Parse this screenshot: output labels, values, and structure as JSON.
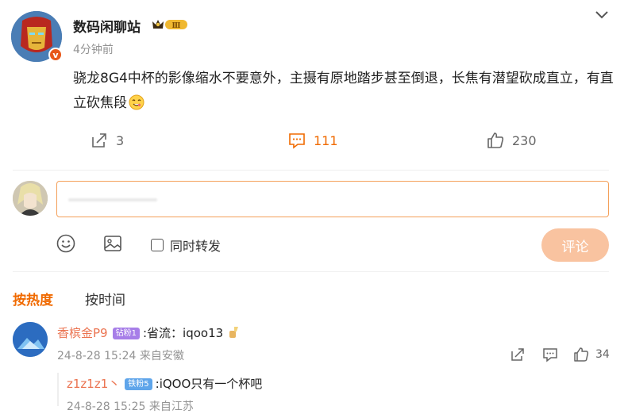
{
  "post": {
    "username": "数码闲聊站",
    "level_badge": "Ⅲ",
    "verified_badge": "v",
    "time": "4分钟前",
    "text": "骁龙8G4中杯的影像缩水不要意外，主摄有原地踏步甚至倒退，长焦有潜望砍成直立，有直立砍焦段",
    "text_emoji": "yummy-face-emoji"
  },
  "actions": {
    "share_count": "3",
    "comment_count": "111",
    "like_count": "230"
  },
  "compose": {
    "placeholder": "",
    "repost_label": "同时转发",
    "submit_label": "评论"
  },
  "sort": {
    "hot_label": "按热度",
    "time_label": "按时间"
  },
  "comments": [
    {
      "username": "香槟金P9",
      "badge": "钻粉1",
      "text": ":省流：iqoo13",
      "meta": "24-8-28 15:24 来自安徽",
      "like_count": "34",
      "replies": [
        {
          "username": "z1z1z1丶",
          "badge": "铁粉5",
          "text": ":iQOO只有一个杯吧",
          "meta": "24-8-28 15:25 来自江苏"
        }
      ]
    }
  ],
  "colors": {
    "accent": "#f06a00",
    "username": "#eb7350",
    "muted": "#939393",
    "submit_bg": "#f9c3a0",
    "input_border": "#f4a05a"
  },
  "icons": [
    "chevron-down-icon",
    "share-icon",
    "comment-icon",
    "like-icon",
    "emoji-icon",
    "image-icon",
    "checkbox-icon",
    "reply-icon"
  ]
}
